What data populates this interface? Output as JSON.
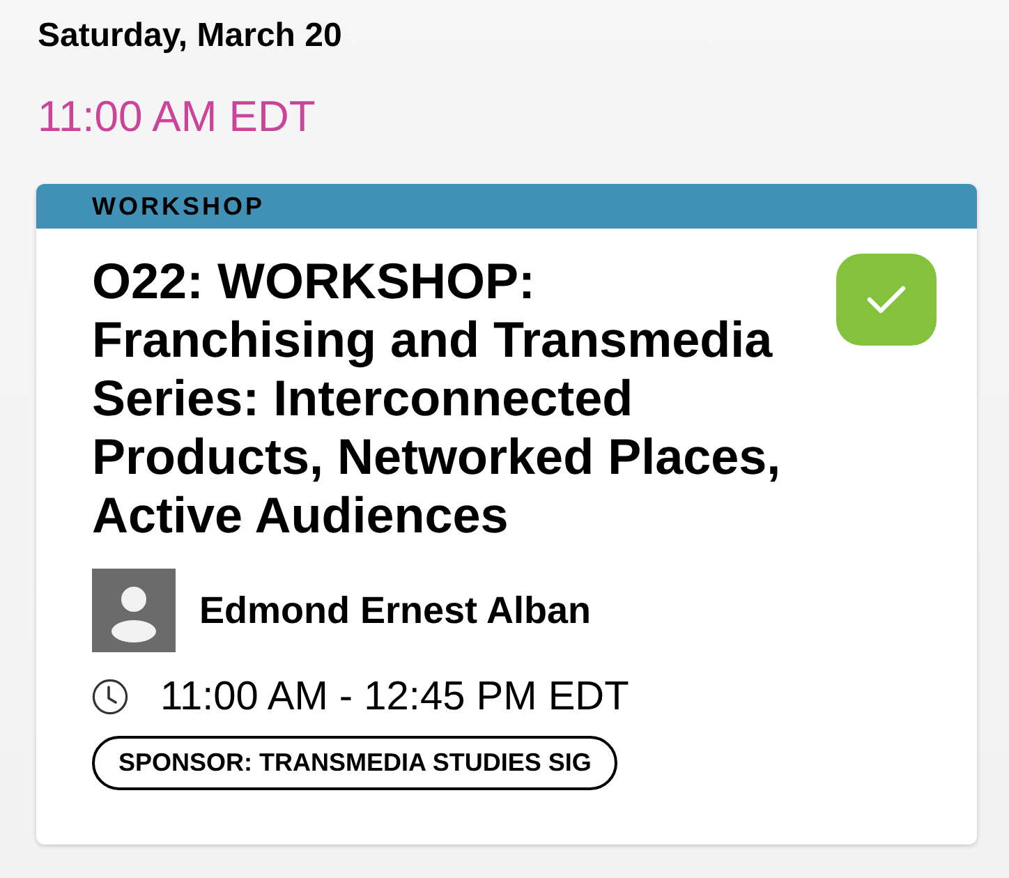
{
  "date_heading": "Saturday, March 20",
  "time_heading": "11:00 AM EDT",
  "session": {
    "category": "WORKSHOP",
    "title": "O22: WORKSHOP: Franchising and Transmedia Series: Interconnected Products, Networked Places, Active Audiences",
    "added": true,
    "speakers": [
      {
        "name": "Edmond Ernest Alban"
      }
    ],
    "time": "11:00 AM - 12:45 PM EDT",
    "tags": [
      {
        "label": "SPONSOR: TRANSMEDIA STUDIES SIG"
      }
    ]
  }
}
